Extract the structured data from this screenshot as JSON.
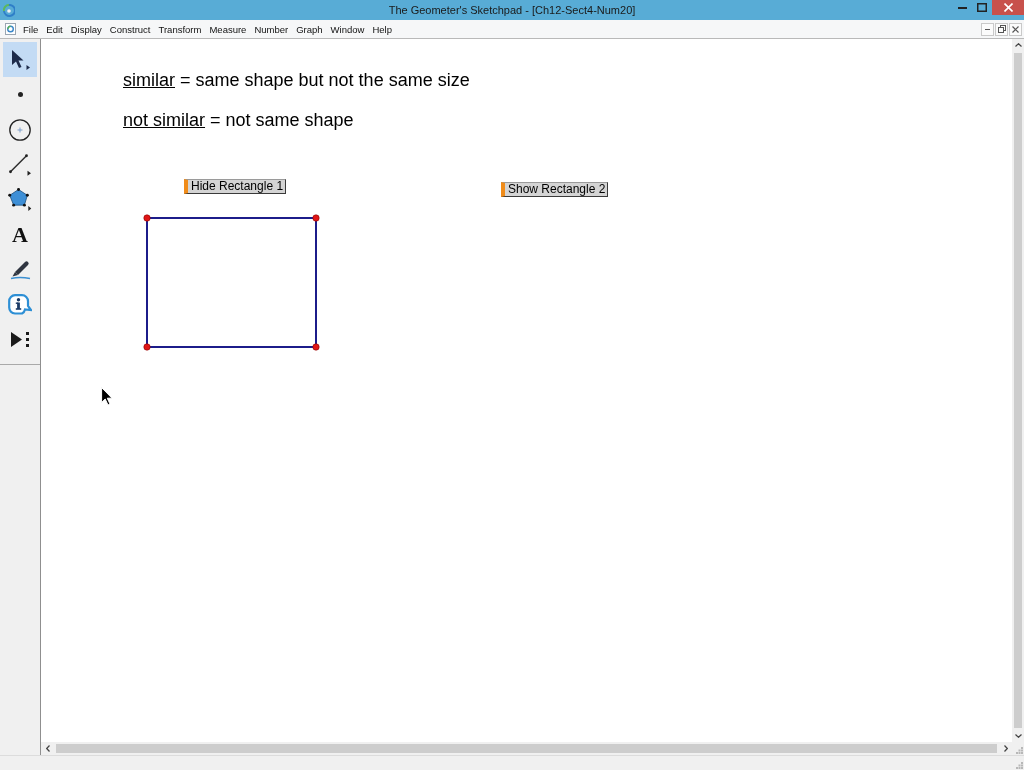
{
  "window": {
    "title": "The Geometer's Sketchpad - [Ch12-Sect4-Num20]"
  },
  "menu_bar": [
    "File",
    "Edit",
    "Display",
    "Construct",
    "Transform",
    "Measure",
    "Number",
    "Graph",
    "Window",
    "Help"
  ],
  "toolbox": [
    {
      "kind": "arrow",
      "selected": true
    },
    {
      "kind": "point",
      "selected": false
    },
    {
      "kind": "compass",
      "selected": false
    },
    {
      "kind": "straightedge",
      "selected": false
    },
    {
      "kind": "polygon",
      "selected": false
    },
    {
      "kind": "text",
      "glyph": "A",
      "selected": false
    },
    {
      "kind": "marker",
      "selected": false
    },
    {
      "kind": "information",
      "selected": false
    },
    {
      "kind": "custom",
      "selected": false
    }
  ],
  "canvas": {
    "captions": [
      {
        "term": "similar",
        "definition": "= same shape but not the same size"
      },
      {
        "term": "not similar",
        "definition": "= not same shape"
      }
    ],
    "action_buttons": [
      {
        "label": "Hide Rectangle 1"
      },
      {
        "label": "Show Rectangle 2"
      }
    ],
    "shapes": [
      {
        "kind": "rectangle"
      }
    ]
  }
}
